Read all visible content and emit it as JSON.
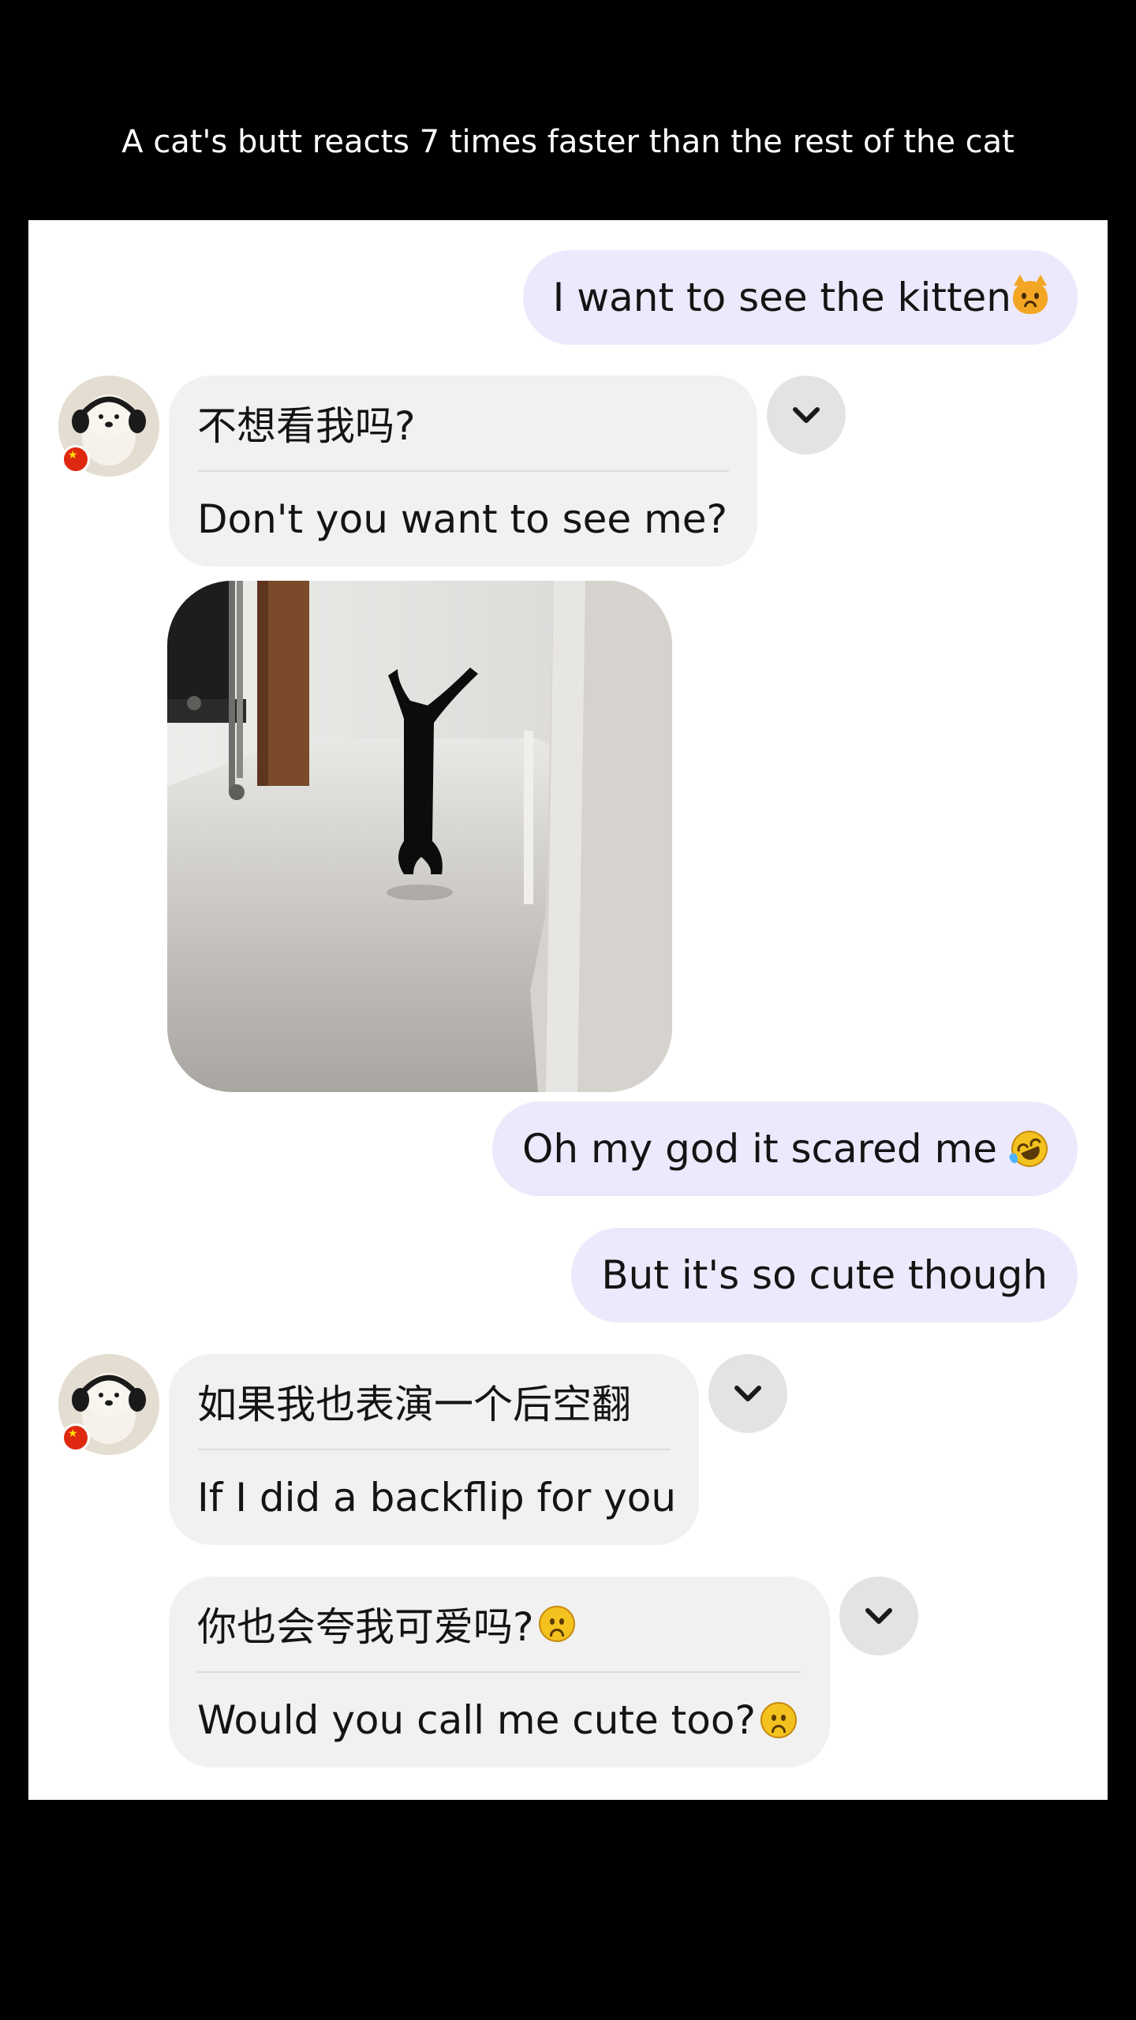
{
  "caption": "A cat's butt reacts 7 times faster than the rest of the cat",
  "messages": {
    "m1": {
      "text": "I want to see the kitten",
      "emoji": "cat-face-icon"
    },
    "m2": {
      "original": "不想看我吗?",
      "translation": "Don't you want to see me?"
    },
    "m3": {
      "media": "photo of a black cat standing upright on its front paws in a hallway"
    },
    "m4": {
      "text": "Oh my god it scared me",
      "emoji": "rolling-on-floor-laughing-icon"
    },
    "m5": {
      "text": "But it's so cute though"
    },
    "m6": {
      "original": "如果我也表演一个后空翻",
      "translation": "If I did a backflip for you"
    },
    "m7": {
      "original": "你也会夸我可爱吗? ",
      "translation": "Would you call me cute too? ",
      "emoji": "frowning-face-icon"
    }
  },
  "contact": {
    "avatar": "bear-with-headphones-avatar",
    "flag": "china-flag-icon"
  },
  "colors": {
    "outgoing_bubble": "#ece9fc",
    "incoming_bubble": "#f1f1f1",
    "toggle_button": "#e3e3e3",
    "background": "#000000",
    "chat_background": "#ffffff"
  }
}
